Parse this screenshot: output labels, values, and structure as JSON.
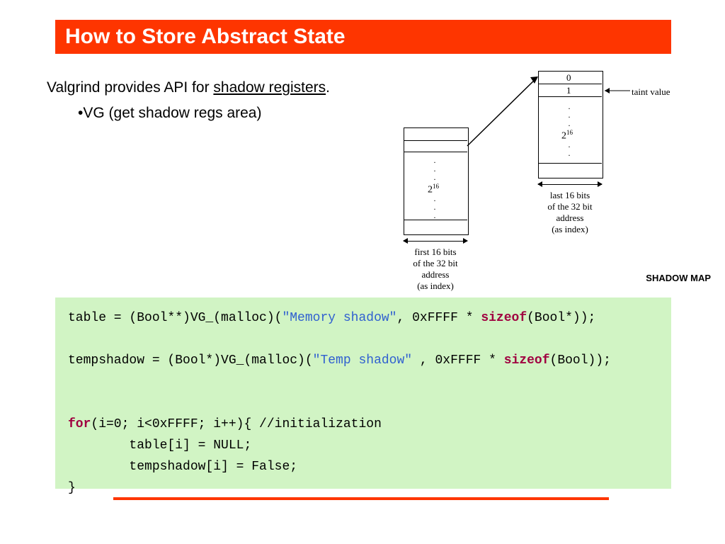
{
  "title": "How to Store Abstract State",
  "body": {
    "text_before": "Valgrind provides API for ",
    "text_underlined": "shadow registers",
    "text_after": ".",
    "bullet": "•VG (get shadow regs area)"
  },
  "diagram": {
    "left_box": {
      "dots": "·",
      "value": "2",
      "exp": "16",
      "caption": "first 16 bits\nof the 32 bit\naddress\n(as index)"
    },
    "right_box": {
      "row0": "0",
      "row1": "1",
      "value": "2",
      "exp": "16",
      "taint": "taint value",
      "caption": "last 16 bits\nof the 32 bit\naddress\n(as index)"
    },
    "shadow_map": "SHADOW MAP"
  },
  "code": {
    "l1a": "table = (Bool**)VG_(malloc)(",
    "l1s": "\"Memory shadow\"",
    "l1b": ", 0xFFFF * ",
    "l1k": "sizeof",
    "l1c": "(Bool*));",
    "l2a": "tempshadow = (Bool*)VG_(malloc)(",
    "l2s": "\"Temp shadow\"",
    "l2b": " , 0xFFFF * ",
    "l2k": "sizeof",
    "l2c": "(Bool));",
    "l3k": "for",
    "l3a": "(i=0; i<0xFFFF; i++){ //initialization",
    "l4": "        table[i] = NULL;",
    "l5": "        tempshadow[i] = False;",
    "l6": "}"
  }
}
